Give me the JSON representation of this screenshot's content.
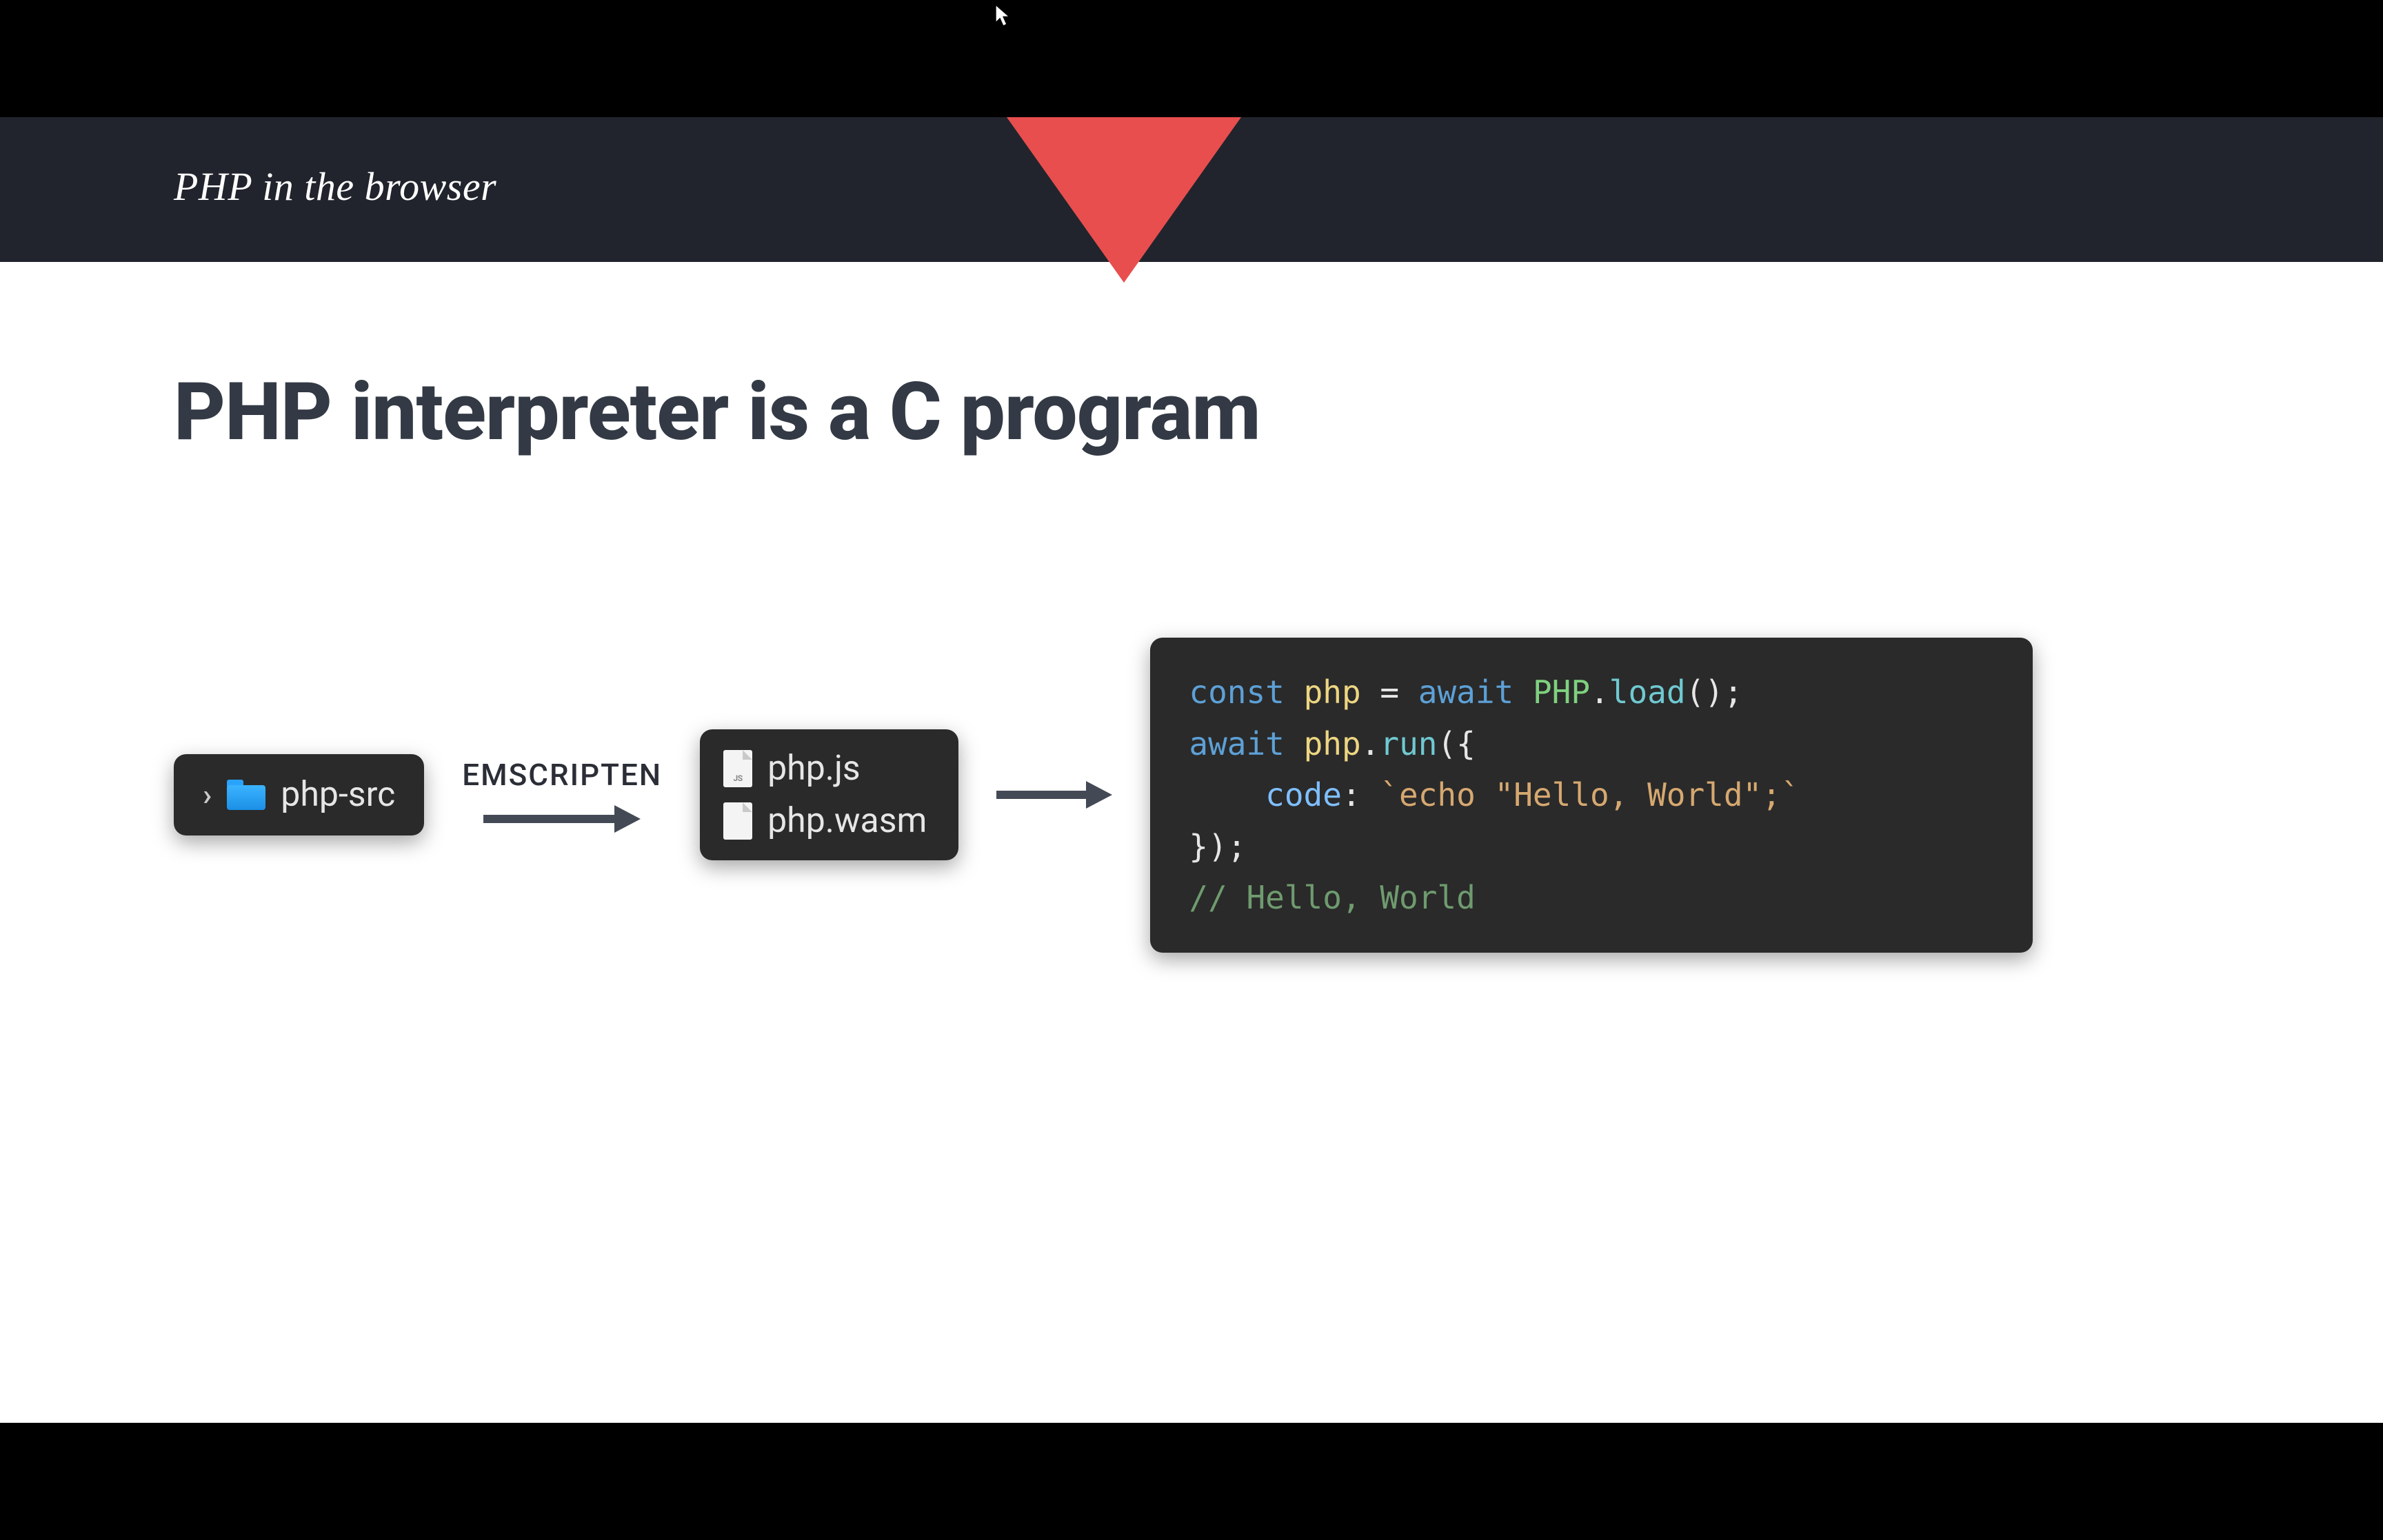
{
  "header": {
    "breadcrumb": "PHP in the browser"
  },
  "title": "PHP interpreter is a C program",
  "diagram": {
    "source_folder": "php-src",
    "arrow1_label": "EMSCRIPTEN",
    "files": {
      "js": "php.js",
      "wasm": "php.wasm"
    },
    "code": {
      "line1": {
        "kw1": "const",
        "var": "php",
        "eq": " = ",
        "kw2": "await",
        "cls": "PHP",
        "dot": ".",
        "fn": "load",
        "paren": "();"
      },
      "line2": {
        "kw": "await",
        "var": "php",
        "dot": ".",
        "fn": "run",
        "open": "({"
      },
      "line3": {
        "indent": "    ",
        "prop": "code",
        "colon": ": ",
        "str": "`echo \"Hello, World\";`"
      },
      "line4": {
        "close": "});"
      },
      "line5": {
        "comment": "// Hello, World"
      }
    }
  }
}
